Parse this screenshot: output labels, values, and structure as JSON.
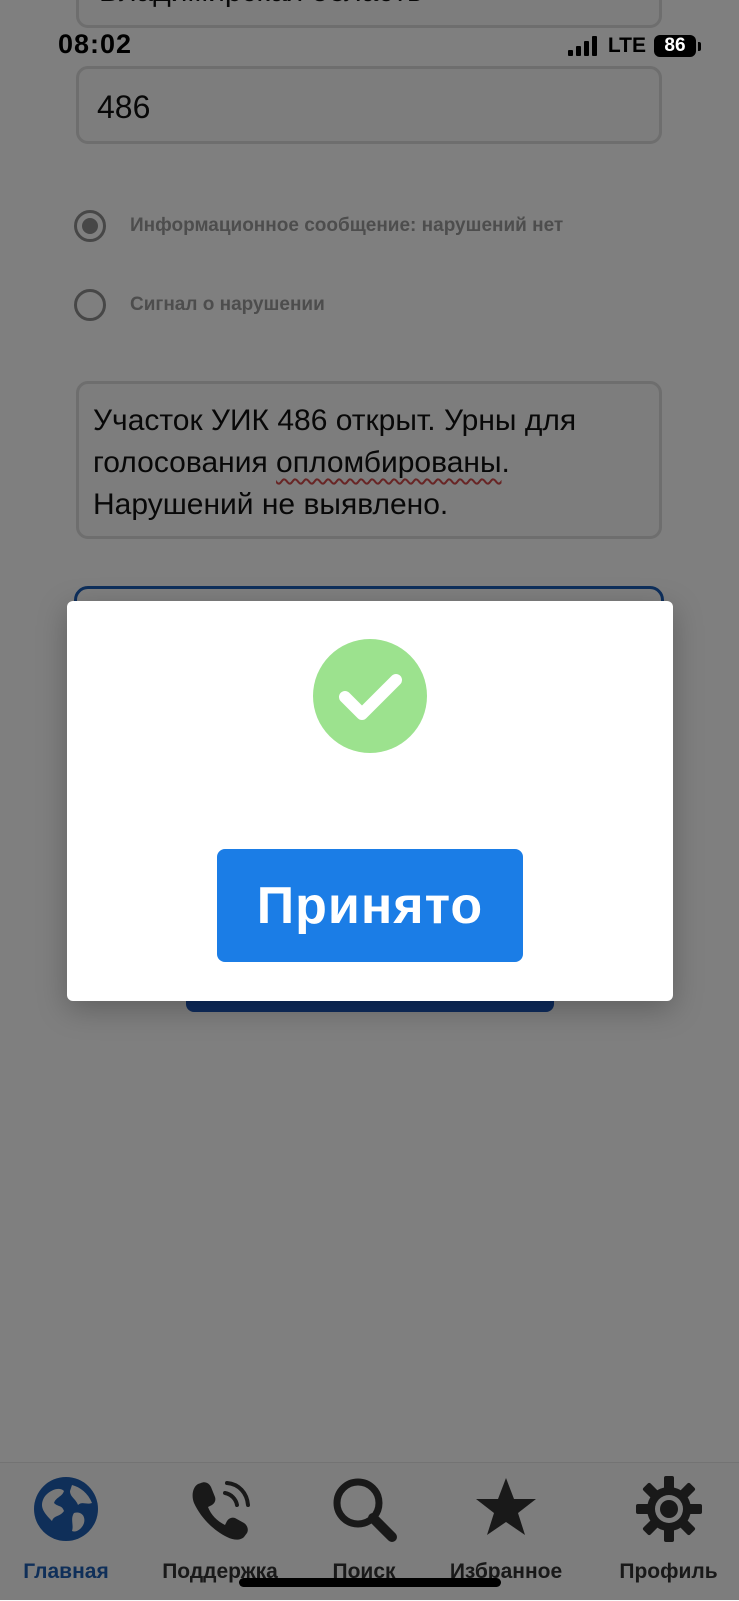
{
  "status_bar": {
    "time": "08:02",
    "network": "LTE",
    "battery": "86"
  },
  "form": {
    "region_value": "Владимирская область",
    "uik_number": "486",
    "report_types": [
      {
        "label": "Информационное сообщение: нарушений нет",
        "checked": true
      },
      {
        "label": "Сигнал о нарушении",
        "checked": false
      }
    ],
    "message_parts": {
      "before": "Участок УИК 486 открыт. Урны для голосования ",
      "misspelled": "опломбированы",
      "after": ". Нарушений не выявлено."
    }
  },
  "modal": {
    "icon": "checkmark-success-icon",
    "accept_label": "Принято",
    "success_color": "#9ce28e",
    "button_color": "#1b7de6"
  },
  "tabbar": {
    "items": [
      {
        "label": "Главная",
        "icon": "globe-icon",
        "active": true
      },
      {
        "label": "Поддержка",
        "icon": "phone-icon",
        "active": false
      },
      {
        "label": "Поиск",
        "icon": "search-icon",
        "active": false
      },
      {
        "label": "Избранное",
        "icon": "star-icon",
        "active": false
      },
      {
        "label": "Профиль",
        "icon": "gear-icon",
        "active": false
      }
    ]
  }
}
